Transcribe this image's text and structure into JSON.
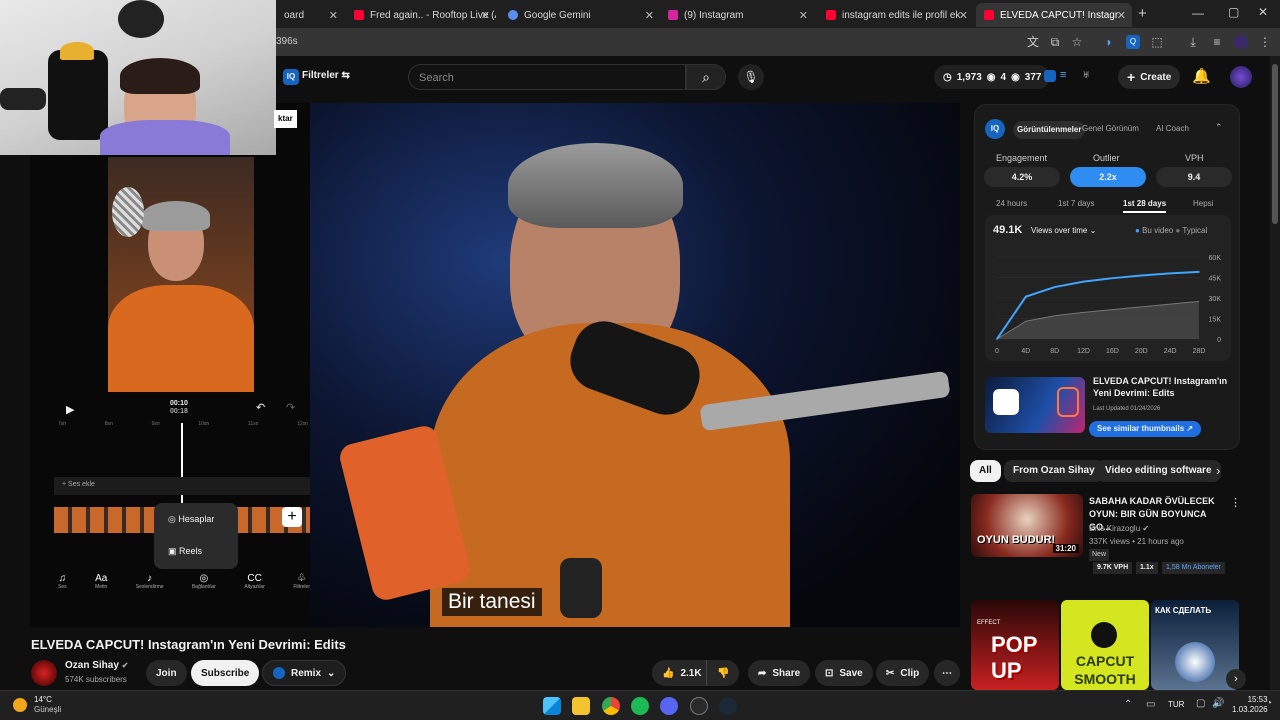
{
  "browser": {
    "tabs": [
      {
        "title": "oard",
        "fav_color": "#00000000"
      },
      {
        "title": "Fred again.. - Rooftop Live (Ar",
        "fav_color": "#ff0033"
      },
      {
        "title": "Google Gemini",
        "fav_color": "#5b8def"
      },
      {
        "title": "(9) Instagram",
        "fav_color": "#d6249f"
      },
      {
        "title": "instagram edits ile profil eklem",
        "fav_color": "#ff0033"
      },
      {
        "title": "ELVEDA CAPCUT! Instagram'ın",
        "fav_color": "#ff0033"
      }
    ],
    "url": "396s",
    "new_tab": "+",
    "close": "✕"
  },
  "header": {
    "filter_label": "Filtreler",
    "search_placeholder": "Search",
    "stats": {
      "views": "1,973",
      "eye": "4",
      "third": "377"
    },
    "create_label": "Create"
  },
  "cam_badge": "ktar",
  "editor": {
    "timecode_current": "00:10",
    "timecode_total": "00:18",
    "ruler": [
      "7sn",
      "8sn",
      "9sn",
      "10sn",
      "11sn",
      "12sn"
    ],
    "add_sound": "Ses ekle",
    "menu": [
      {
        "label": "Hesaplar"
      },
      {
        "label": "Reels"
      }
    ],
    "tools": [
      "Ses",
      "Metin",
      "Seslendirme",
      "Bağlantılar",
      "Altyazılar",
      "Filtreler"
    ]
  },
  "video": {
    "subtitle": "Bir tanesi",
    "title": "ELVEDA CAPCUT! Instagram'ın Yeni Devrimi: Edits"
  },
  "channel": {
    "name": "Ozan Sihay",
    "subscribers": "574K subscribers",
    "join": "Join",
    "subscribe": "Subscribe",
    "remix": "Remix"
  },
  "actions": {
    "likes": "2.1K",
    "share": "Share",
    "save": "Save",
    "clip": "Clip"
  },
  "iq": {
    "tabs": [
      "Görüntülenmeler",
      "Genel Görünüm",
      "AI Coach"
    ],
    "metrics": [
      {
        "label": "Engagement",
        "value": "4.2%"
      },
      {
        "label": "Outlier",
        "value": "2.2x"
      },
      {
        "label": "VPH",
        "value": "9.4"
      }
    ],
    "ranges": [
      "24 hours",
      "1st 7 days",
      "1st 28 days",
      "Hepsi"
    ],
    "active_range": "1st 28 days",
    "total": "49.1K",
    "view_select": "Views over time",
    "legend": [
      "Bu video",
      "Typical"
    ],
    "thumb_title": "ELVEDA CAPCUT! Instagram'ın Yeni Devrimi: Edits",
    "updated": "Last Updated 01/24/2026",
    "similar_btn": "See similar thumbnails"
  },
  "chart_data": {
    "type": "area",
    "x": [
      "0",
      "4D",
      "8D",
      "12D",
      "16D",
      "20D",
      "24D",
      "28D"
    ],
    "yticks": [
      "60K",
      "45K",
      "30K",
      "15K",
      "0"
    ],
    "ylim": [
      0,
      60000
    ],
    "series": [
      {
        "name": "Bu video",
        "values": [
          0,
          31000,
          38000,
          42000,
          44500,
          46500,
          48000,
          49100
        ]
      },
      {
        "name": "Typical",
        "values": [
          0,
          13000,
          17000,
          19500,
          21500,
          23500,
          25500,
          27500
        ]
      }
    ],
    "colors": {
      "bu_video": "#3ea6ff",
      "typical": "#777777"
    }
  },
  "chips": [
    "All",
    "From Ozan Sihay",
    "Video editing software"
  ],
  "recommended": {
    "title": "SABAHA KADAR ÖVÜLECEK OYUN: BIR GÜN BOYUNCA GO...",
    "channel": "Enis Kirazoglu",
    "meta": "337K views • 21 hours ago",
    "badge_new": "New",
    "vph": "9.7K VPH",
    "mult": "1.1x",
    "subs": "1,58 Mn Aboneler",
    "duration": "31:20",
    "thumb_text": "OYUN BUDUR!"
  },
  "shorts": [
    {
      "text": "POP UP",
      "top": "EFFECT"
    },
    {
      "text": "CAPCUT SMOOTH"
    },
    {
      "text": "КАК СДЕЛАТЬ"
    }
  ],
  "taskbar": {
    "weather_temp": "14°C",
    "weather_desc": "Güneşli",
    "lang": "TUR",
    "time": "15:53",
    "date": "1.03.2026"
  }
}
